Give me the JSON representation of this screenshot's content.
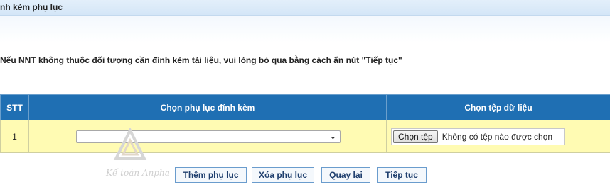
{
  "header": {
    "title": "nh kèm phụ lục"
  },
  "notice": "Nếu NNT không thuộc đối tượng cần đính kèm tài liệu, vui lòng bỏ qua bằng cách ấn nút \"Tiếp tục\"",
  "table": {
    "columns": [
      "STT",
      "Chọn phụ lục đính kèm",
      "Chọn tệp dữ liệu"
    ],
    "rows": [
      {
        "stt": "1",
        "appendix_selected": "",
        "file_button": "Chọn tệp",
        "file_status": "Không có tệp nào được chọn"
      }
    ]
  },
  "watermark": {
    "text": "Kế toán Anpha"
  },
  "buttons": {
    "add": "Thêm phụ lục",
    "delete": "Xóa phụ lục",
    "back": "Quay lại",
    "next": "Tiếp tục"
  },
  "colors": {
    "header_bg": "#1f6fb3",
    "row_bg": "#fffbb3",
    "button_border": "#6a9ccd"
  }
}
